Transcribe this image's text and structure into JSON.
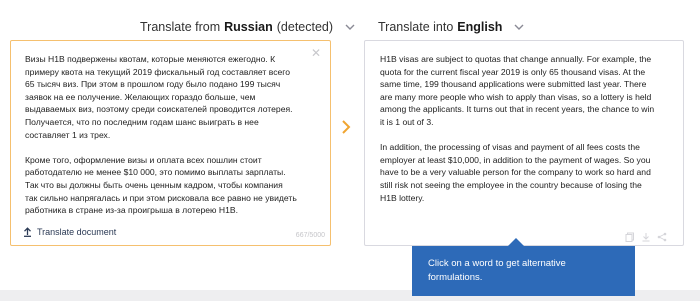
{
  "source": {
    "header_prefix": "Translate from",
    "language": "Russian",
    "detected": "(detected)",
    "text": "Визы H1B подвержены квотам, которые меняются ежегодно. К\nпримеру квота на текущий 2019 фискальный год составляет всего\n65 тысяч виз. При этом в прошлом году было подано 199 тысяч\nзаявок на ее получение. Желающих гораздо больше, чем\nвыдаваемых виз, поэтому среди соискателей проводится лотерея.\nПолучается, что по последним годам шанс выиграть в нее\nсоставляет 1 из трех.\n\nКроме того, оформление визы и оплата всех пошлин стоит\nработодателю не менее $10 000, это помимо выплаты зарплаты.\nТак что вы должны быть очень ценным кадром, чтобы компания\nтак сильно напрягалась и при этом рисковала все равно не увидеть\nработника в стране из-за проигрыша в лотерею H1B.",
    "translate_document_label": "Translate document",
    "char_count": "667/5000"
  },
  "target": {
    "header_prefix": "Translate into",
    "language": "English",
    "text": "H1B visas are subject to quotas that change annually. For example, the\nquota for the current fiscal year 2019 is only 65 thousand visas. At the\nsame time, 199 thousand applications were submitted last year. There\nare many more people who wish to apply than visas, so a lottery is held\namong the applicants. It turns out that in recent years, the chance to win\nit is 1 out of 3.\n\nIn addition, the processing of visas and payment of all fees costs the\nemployer at least $10,000, in addition to the payment of wages. So you\nhave to be a very valuable person for the company to work so hard and\nstill risk not seeing the employee in the country because of losing the\nH1B lottery."
  },
  "tooltip": {
    "text": "Click on a word to get alternative\nformulations."
  },
  "icons": {
    "source_language_dropdown": "chevron-down-icon",
    "target_language_dropdown": "chevron-down-icon",
    "close": "close-icon",
    "upload": "upload-icon",
    "swap": "chevron-right-icon",
    "copy": "copy-icon",
    "download": "download-icon",
    "share": "share-icon"
  },
  "colors": {
    "source_border": "#f5c06f",
    "accent_arrow": "#f0a531",
    "tooltip_bg": "#2d6ab8",
    "target_border": "#d9d9e0"
  }
}
